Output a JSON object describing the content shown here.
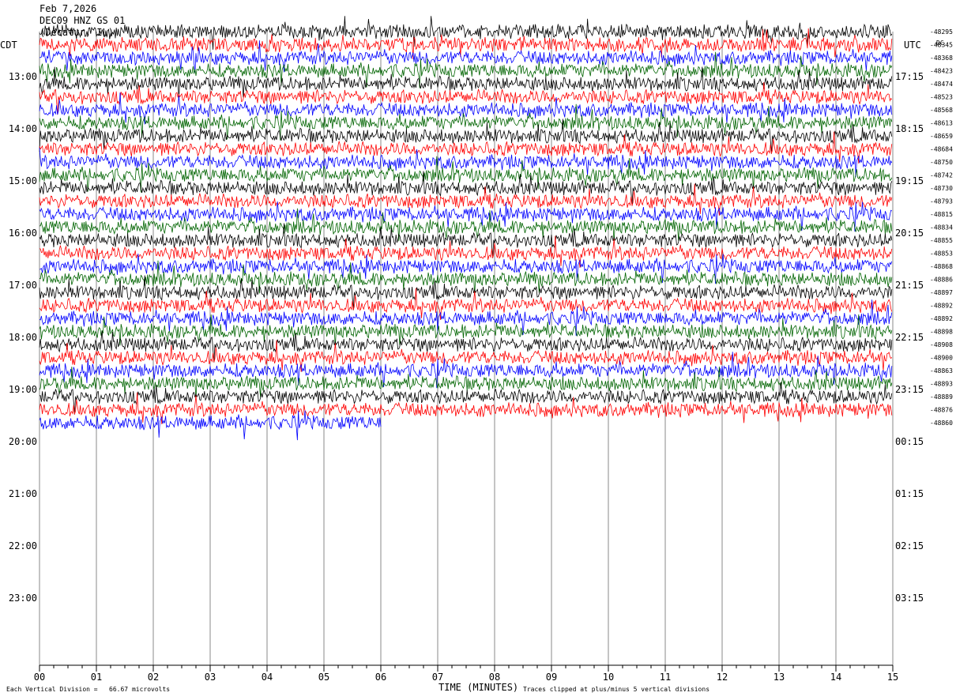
{
  "header": {
    "date": "Feb 7,2026",
    "station": "DEC09 HNZ GS 01",
    "location": "(Decatur, IL)"
  },
  "footer": {
    "scale_note": "Each Vertical Division =   66.67 microvolts",
    "clip_note": "Traces clipped at plus/minus 5 vertical divisions"
  },
  "chart_data": {
    "type": "line",
    "title": "",
    "xlabel": "TIME (MINUTES)",
    "left_axis_label": "CDT",
    "right_axis_label": "UTC",
    "dc_label": "DC",
    "xlim": [
      0,
      15
    ],
    "x_ticks": [
      "00",
      "01",
      "02",
      "03",
      "04",
      "05",
      "06",
      "07",
      "08",
      "09",
      "10",
      "11",
      "12",
      "13",
      "14",
      "15"
    ],
    "y_labels_cdt": [
      "13:00",
      "14:00",
      "15:00",
      "16:00",
      "17:00",
      "18:00",
      "19:00",
      "20:00",
      "21:00",
      "22:00",
      "23:00"
    ],
    "y_labels_utc": [
      "17:15",
      "18:15",
      "19:15",
      "20:15",
      "21:15",
      "22:15",
      "23:15",
      "00:15",
      "01:15",
      "02:15",
      "03:15"
    ],
    "trace_colors": [
      "#000000",
      "#ff0000",
      "#0000ff",
      "#006400"
    ],
    "traces_per_hour": 4,
    "minutes_per_trace": 15,
    "grid_vertical": true,
    "dc_offsets": [
      "-48295",
      "-48345",
      "-48368",
      "-48423",
      "-48474",
      "-48523",
      "-48568",
      "-48613",
      "-48659",
      "-48684",
      "-48750",
      "-48742",
      "-48730",
      "-48793",
      "-48815",
      "-48834",
      "-48855",
      "-48853",
      "-48868",
      "-48886",
      "-48897",
      "-48892",
      "-48892",
      "-48898",
      "-48908",
      "-48900",
      "-48863",
      "-48893",
      "-48889",
      "-48876",
      "-48860"
    ],
    "last_trace_end_minute": 6.0,
    "clipped_divisions": 5
  }
}
